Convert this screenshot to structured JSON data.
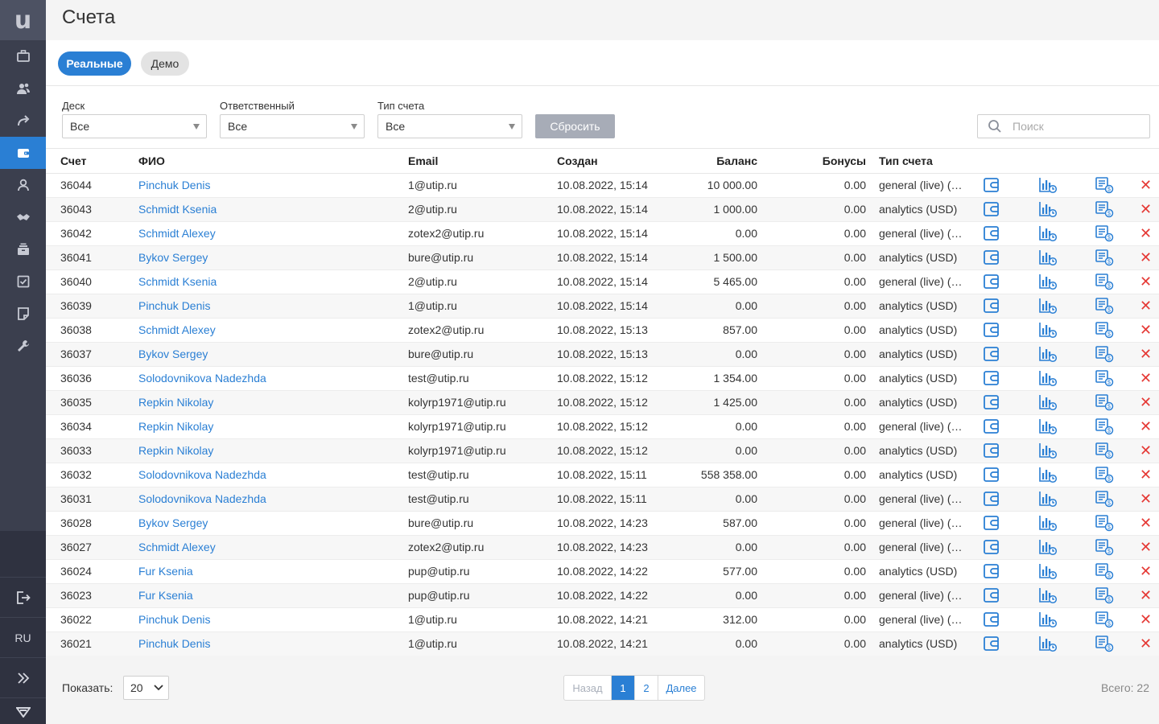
{
  "sidebar": {
    "logo": "u",
    "items": [
      {
        "name": "briefcase"
      },
      {
        "name": "users"
      },
      {
        "name": "share"
      },
      {
        "name": "wallet",
        "active": true
      },
      {
        "name": "user"
      },
      {
        "name": "handshake"
      },
      {
        "name": "archive"
      },
      {
        "name": "checkbox"
      },
      {
        "name": "note"
      },
      {
        "name": "wrench"
      }
    ],
    "bottom": {
      "logout": "logout-icon",
      "lang": "RU",
      "expand": "chevrons-right-icon",
      "brand": "brand-logo-icon"
    }
  },
  "header": {
    "title": "Счета"
  },
  "tabs": {
    "real": "Реальные",
    "demo": "Демо"
  },
  "filters": {
    "desk": {
      "label": "Деск",
      "value": "Все"
    },
    "responsible": {
      "label": "Ответственный",
      "value": "Все"
    },
    "account_type": {
      "label": "Тип счета",
      "value": "Все"
    },
    "reset": "Сбросить",
    "search_placeholder": "Поиск"
  },
  "table": {
    "columns": {
      "account": "Счет",
      "name": "ФИО",
      "email": "Email",
      "created": "Создан",
      "balance": "Баланс",
      "bonus": "Бонусы",
      "type": "Тип счета"
    },
    "rows": [
      {
        "account": "36044",
        "name": "Pinchuk Denis",
        "email": "1@utip.ru",
        "created": "10.08.2022, 15:14",
        "balance": "10 000.00",
        "bonus": "0.00",
        "type": "general (live) (USD)"
      },
      {
        "account": "36043",
        "name": "Schmidt Ksenia",
        "email": "2@utip.ru",
        "created": "10.08.2022, 15:14",
        "balance": "1 000.00",
        "bonus": "0.00",
        "type": "analytics (USD)"
      },
      {
        "account": "36042",
        "name": "Schmidt Alexey",
        "email": "zotex2@utip.ru",
        "created": "10.08.2022, 15:14",
        "balance": "0.00",
        "bonus": "0.00",
        "type": "general (live) (USD)"
      },
      {
        "account": "36041",
        "name": "Bykov Sergey",
        "email": "bure@utip.ru",
        "created": "10.08.2022, 15:14",
        "balance": "1 500.00",
        "bonus": "0.00",
        "type": "analytics (USD)"
      },
      {
        "account": "36040",
        "name": "Schmidt Ksenia",
        "email": "2@utip.ru",
        "created": "10.08.2022, 15:14",
        "balance": "5 465.00",
        "bonus": "0.00",
        "type": "general (live) (USD)"
      },
      {
        "account": "36039",
        "name": "Pinchuk Denis",
        "email": "1@utip.ru",
        "created": "10.08.2022, 15:14",
        "balance": "0.00",
        "bonus": "0.00",
        "type": "analytics (USD)"
      },
      {
        "account": "36038",
        "name": "Schmidt Alexey",
        "email": "zotex2@utip.ru",
        "created": "10.08.2022, 15:13",
        "balance": "857.00",
        "bonus": "0.00",
        "type": "analytics (USD)"
      },
      {
        "account": "36037",
        "name": "Bykov Sergey",
        "email": "bure@utip.ru",
        "created": "10.08.2022, 15:13",
        "balance": "0.00",
        "bonus": "0.00",
        "type": "analytics (USD)"
      },
      {
        "account": "36036",
        "name": "Solodovnikova Nadezhda",
        "email": "test@utip.ru",
        "created": "10.08.2022, 15:12",
        "balance": "1 354.00",
        "bonus": "0.00",
        "type": "analytics (USD)"
      },
      {
        "account": "36035",
        "name": "Repkin Nikolay",
        "email": "kolyrp1971@utip.ru",
        "created": "10.08.2022, 15:12",
        "balance": "1 425.00",
        "bonus": "0.00",
        "type": "analytics (USD)"
      },
      {
        "account": "36034",
        "name": "Repkin Nikolay",
        "email": "kolyrp1971@utip.ru",
        "created": "10.08.2022, 15:12",
        "balance": "0.00",
        "bonus": "0.00",
        "type": "general (live) (USD)"
      },
      {
        "account": "36033",
        "name": "Repkin Nikolay",
        "email": "kolyrp1971@utip.ru",
        "created": "10.08.2022, 15:12",
        "balance": "0.00",
        "bonus": "0.00",
        "type": "analytics (USD)"
      },
      {
        "account": "36032",
        "name": "Solodovnikova Nadezhda",
        "email": "test@utip.ru",
        "created": "10.08.2022, 15:11",
        "balance": "558 358.00",
        "bonus": "0.00",
        "type": "analytics (USD)"
      },
      {
        "account": "36031",
        "name": "Solodovnikova Nadezhda",
        "email": "test@utip.ru",
        "created": "10.08.2022, 15:11",
        "balance": "0.00",
        "bonus": "0.00",
        "type": "general (live) (USD)"
      },
      {
        "account": "36028",
        "name": "Bykov Sergey",
        "email": "bure@utip.ru",
        "created": "10.08.2022, 14:23",
        "balance": "587.00",
        "bonus": "0.00",
        "type": "general (live) (USD)"
      },
      {
        "account": "36027",
        "name": "Schmidt Alexey",
        "email": "zotex2@utip.ru",
        "created": "10.08.2022, 14:23",
        "balance": "0.00",
        "bonus": "0.00",
        "type": "general (live) (USD)"
      },
      {
        "account": "36024",
        "name": "Fur Ksenia",
        "email": "pup@utip.ru",
        "created": "10.08.2022, 14:22",
        "balance": "577.00",
        "bonus": "0.00",
        "type": "analytics (USD)"
      },
      {
        "account": "36023",
        "name": "Fur Ksenia",
        "email": "pup@utip.ru",
        "created": "10.08.2022, 14:22",
        "balance": "0.00",
        "bonus": "0.00",
        "type": "general (live) (USD)"
      },
      {
        "account": "36022",
        "name": "Pinchuk Denis",
        "email": "1@utip.ru",
        "created": "10.08.2022, 14:21",
        "balance": "312.00",
        "bonus": "0.00",
        "type": "general (live) (USD)"
      },
      {
        "account": "36021",
        "name": "Pinchuk Denis",
        "email": "1@utip.ru",
        "created": "10.08.2022, 14:21",
        "balance": "0.00",
        "bonus": "0.00",
        "type": "analytics (USD)"
      }
    ],
    "row_icons": [
      "wallet-icon",
      "chart-history-icon",
      "transactions-icon",
      "delete-icon"
    ],
    "delete_glyph": "✕"
  },
  "footer": {
    "show_label": "Показать:",
    "per_page": "20",
    "prev": "Назад",
    "pages": [
      "1",
      "2"
    ],
    "next": "Далее",
    "total": "Всего: 22"
  },
  "colors": {
    "accent": "#2a7fd4",
    "sidebar": "#3b3f4e",
    "delete": "#e53935"
  }
}
